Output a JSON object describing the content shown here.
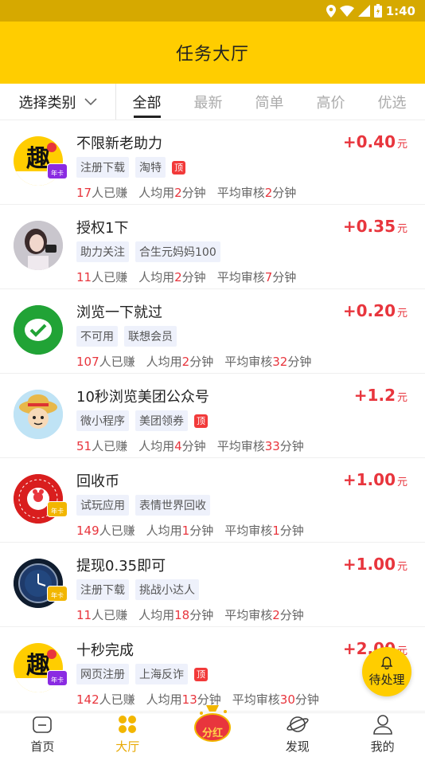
{
  "status_bar": {
    "time": "1:40"
  },
  "header": {
    "title": "任务大厅"
  },
  "filter": {
    "category_label": "选择类别",
    "tabs": [
      "全部",
      "最新",
      "简单",
      "高价",
      "优选"
    ]
  },
  "tasks": [
    {
      "name": "不限新老助力",
      "tags": [
        "注册下载",
        "淘特"
      ],
      "top": "顶",
      "count": "17",
      "count_suffix": "人已赚",
      "avg_prefix": "人均用",
      "avg": "2",
      "avg_unit": "分钟",
      "review_prefix": "平均审核",
      "review": "2",
      "review_unit": "分钟",
      "amount": "+0.40",
      "unit": "元",
      "badge": "年卡"
    },
    {
      "name": "授权1下",
      "tags": [
        "助力关注",
        "合生元妈妈100"
      ],
      "top": "",
      "count": "11",
      "count_suffix": "人已赚",
      "avg_prefix": "人均用",
      "avg": "2",
      "avg_unit": "分钟",
      "review_prefix": "平均审核",
      "review": "7",
      "review_unit": "分钟",
      "amount": "+0.35",
      "unit": "元",
      "badge": ""
    },
    {
      "name": "浏览一下就过",
      "tags": [
        "不可用",
        "联想会员"
      ],
      "top": "",
      "count": "107",
      "count_suffix": "人已赚",
      "avg_prefix": "人均用",
      "avg": "2",
      "avg_unit": "分钟",
      "review_prefix": "平均审核",
      "review": "32",
      "review_unit": "分钟",
      "amount": "+0.20",
      "unit": "元",
      "badge": ""
    },
    {
      "name": "10秒浏览美团公众号",
      "tags": [
        "微小程序",
        "美团领券"
      ],
      "top": "顶",
      "count": "51",
      "count_suffix": "人已赚",
      "avg_prefix": "人均用",
      "avg": "4",
      "avg_unit": "分钟",
      "review_prefix": "平均审核",
      "review": "33",
      "review_unit": "分钟",
      "amount": "+1.2",
      "unit": "元",
      "badge": ""
    },
    {
      "name": "回收币",
      "tags": [
        "试玩应用",
        "表情世界回收"
      ],
      "top": "",
      "count": "149",
      "count_suffix": "人已赚",
      "avg_prefix": "人均用",
      "avg": "1",
      "avg_unit": "分钟",
      "review_prefix": "平均审核",
      "review": "1",
      "review_unit": "分钟",
      "amount": "+1.00",
      "unit": "元",
      "badge": "年卡"
    },
    {
      "name": "提现0.35即可",
      "tags": [
        "注册下载",
        "挑战小达人"
      ],
      "top": "",
      "count": "11",
      "count_suffix": "人已赚",
      "avg_prefix": "人均用",
      "avg": "18",
      "avg_unit": "分钟",
      "review_prefix": "平均审核",
      "review": "2",
      "review_unit": "分钟",
      "amount": "+1.00",
      "unit": "元",
      "badge": "年卡"
    },
    {
      "name": "十秒完成",
      "tags": [
        "网页注册",
        "上海反诈"
      ],
      "top": "顶",
      "count": "142",
      "count_suffix": "人已赚",
      "avg_prefix": "人均用",
      "avg": "13",
      "avg_unit": "分钟",
      "review_prefix": "平均审核",
      "review": "30",
      "review_unit": "分钟",
      "amount": "+2.00",
      "unit": "元",
      "badge": "年卡"
    }
  ],
  "pending_button": {
    "label": "待处理"
  },
  "bottom_nav": {
    "home": "首页",
    "hall": "大厅",
    "dividend": "分红",
    "discover": "发现",
    "mine": "我的"
  },
  "colors": {
    "brand_yellow": "#ffcd00",
    "price_red": "#e8353d",
    "active_nav": "#e8a800"
  }
}
